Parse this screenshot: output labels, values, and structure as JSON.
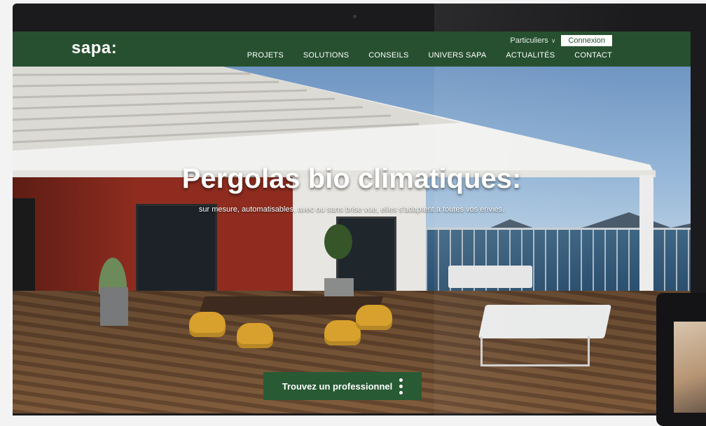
{
  "header": {
    "logo": "sapa:",
    "audience_selector": "Particuliers",
    "login_label": "Connexion",
    "nav": [
      "PROJETS",
      "SOLUTIONS",
      "CONSEILS",
      "UNIVERS SAPA",
      "ACTUALITÉS",
      "CONTACT"
    ]
  },
  "hero": {
    "headline": "Pergolas bio climatiques:",
    "subhead": "sur mesure, automatisables, avec ou sans brise vue, elles s'adaptent à toutes vos envies.",
    "cta_label": "Trouvez un professionnel"
  },
  "colors": {
    "brand_green": "#275030",
    "cta_green": "#285a34"
  }
}
